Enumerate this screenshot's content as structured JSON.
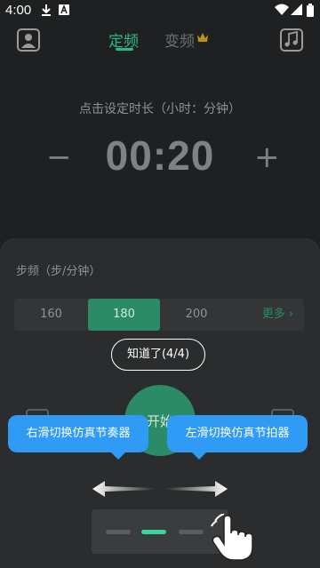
{
  "status_bar": {
    "time": "4:00"
  },
  "header": {
    "tabs": [
      {
        "label": "定频",
        "active": true
      },
      {
        "label": "变频",
        "active": false,
        "badge": "crown-icon"
      }
    ]
  },
  "timer": {
    "hint": "点击设定时长（小时：分钟）",
    "value": "00:20",
    "minus_label": "−",
    "plus_label": "+"
  },
  "cadence": {
    "title": "步频（步/分钟）",
    "options": [
      "160",
      "180",
      "200"
    ],
    "selected": "180",
    "more_label": "更多 ›"
  },
  "overlay": {
    "got_it_label": "知道了(4/4)",
    "start_label": "开始",
    "bubble_left": "右滑切换仿真节奏器",
    "bubble_right": "左滑切换仿真节拍器",
    "pager_active_index": 1
  },
  "colors": {
    "accent": "#2fb687",
    "tooltip": "#2f9bf5",
    "background": "#1e2021"
  }
}
